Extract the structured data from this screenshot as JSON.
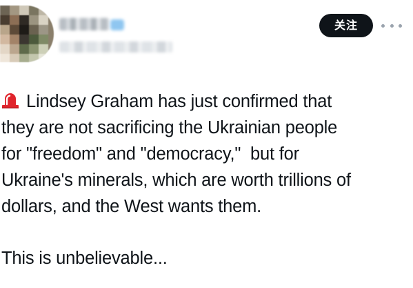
{
  "header": {
    "follow_label": "关注",
    "more_icon": "more-horizontal-icon"
  },
  "tweet": {
    "emoji_icon": "rotating-light-icon",
    "lines": [
      "Lindsey Graham has just confirmed that",
      "they are not sacrificing the Ukrainian people",
      "for \"freedom\" and \"democracy,\"  but for",
      "Ukraine's minerals, which are worth trillions of",
      "dollars, and the West wants them."
    ],
    "closing": "This is unbelievable..."
  },
  "colors": {
    "text": "#0f1419",
    "button_bg": "#0f1419",
    "button_text": "#ffffff",
    "siren_red": "#e0242c"
  }
}
